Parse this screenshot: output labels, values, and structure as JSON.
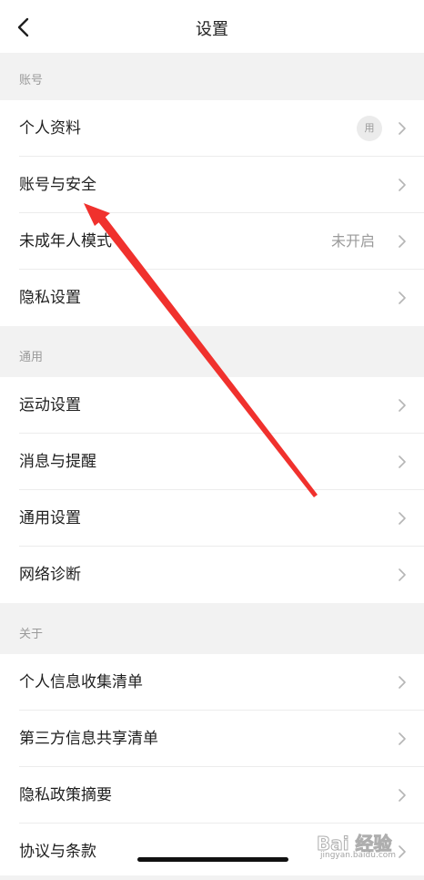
{
  "header": {
    "title": "设置",
    "back_icon": "chevron-left-icon"
  },
  "sections": [
    {
      "title": "账号",
      "items": [
        {
          "label": "个人资料",
          "avatar_text": "用"
        },
        {
          "label": "账号与安全"
        },
        {
          "label": "未成年人模式",
          "value": "未开启"
        },
        {
          "label": "隐私设置"
        }
      ]
    },
    {
      "title": "通用",
      "items": [
        {
          "label": "运动设置"
        },
        {
          "label": "消息与提醒"
        },
        {
          "label": "通用设置"
        },
        {
          "label": "网络诊断"
        }
      ]
    },
    {
      "title": "关于",
      "items": [
        {
          "label": "个人信息收集清单"
        },
        {
          "label": "第三方信息共享清单"
        },
        {
          "label": "隐私政策摘要"
        },
        {
          "label": "协议与条款"
        }
      ]
    }
  ],
  "annotation": {
    "type": "red-arrow",
    "color": "#f0312d"
  },
  "watermark": {
    "main": "Bai 经验",
    "sub": "jingyan.baidu.com"
  },
  "colors": {
    "background": "#f2f2f2",
    "row": "#ffffff",
    "text_primary": "#1f1f1f",
    "text_secondary": "#9a9a9a"
  }
}
